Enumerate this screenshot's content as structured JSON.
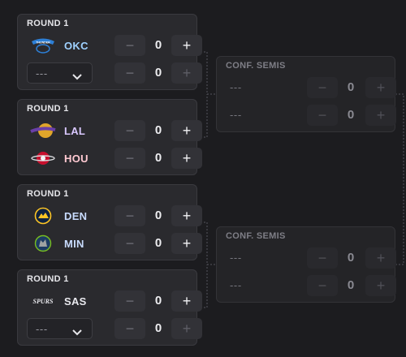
{
  "colors": {
    "background": "#1c1c1f",
    "okc": "#9fd1ff",
    "lal": "#d9c8ff",
    "hou": "#ffc9d2",
    "den": "#c9dcff",
    "min": "#c9dcff",
    "sas": "#e9e9ee"
  },
  "round1": [
    {
      "title": "ROUND 1",
      "team1": {
        "abbr": "OKC",
        "logo": "okc-logo-icon",
        "score": "0",
        "minus": "−",
        "plus": "+"
      },
      "team2": {
        "select": "---",
        "logo": "chevron-down-icon",
        "score": "0",
        "minus": "−",
        "plus": "+"
      }
    },
    {
      "title": "ROUND 1",
      "team1": {
        "abbr": "LAL",
        "logo": "lakers-logo-icon",
        "score": "0",
        "minus": "−",
        "plus": "+"
      },
      "team2": {
        "abbr": "HOU",
        "logo": "rockets-logo-icon",
        "score": "0",
        "minus": "−",
        "plus": "+"
      }
    },
    {
      "title": "ROUND 1",
      "team1": {
        "abbr": "DEN",
        "logo": "nuggets-logo-icon",
        "score": "0",
        "minus": "−",
        "plus": "+"
      },
      "team2": {
        "abbr": "MIN",
        "logo": "timberwolves-logo-icon",
        "score": "0",
        "minus": "−",
        "plus": "+"
      }
    },
    {
      "title": "ROUND 1",
      "team1": {
        "abbr": "SAS",
        "logo": "spurs-logo-icon",
        "score": "0",
        "minus": "−",
        "plus": "+"
      },
      "team2": {
        "select": "---",
        "logo": "chevron-down-icon",
        "score": "0",
        "minus": "−",
        "plus": "+"
      }
    }
  ],
  "semis": [
    {
      "title": "CONF. SEMIS",
      "team1": {
        "name": "---",
        "score": "0",
        "minus": "−",
        "plus": "+"
      },
      "team2": {
        "name": "---",
        "score": "0",
        "minus": "−",
        "plus": "+"
      }
    },
    {
      "title": "CONF. SEMIS",
      "team1": {
        "name": "---",
        "score": "0",
        "minus": "−",
        "plus": "+"
      },
      "team2": {
        "name": "---",
        "score": "0",
        "minus": "−",
        "plus": "+"
      }
    }
  ],
  "spurs_logo_text": "SPURS",
  "okc_logo_text": "THUNDER"
}
